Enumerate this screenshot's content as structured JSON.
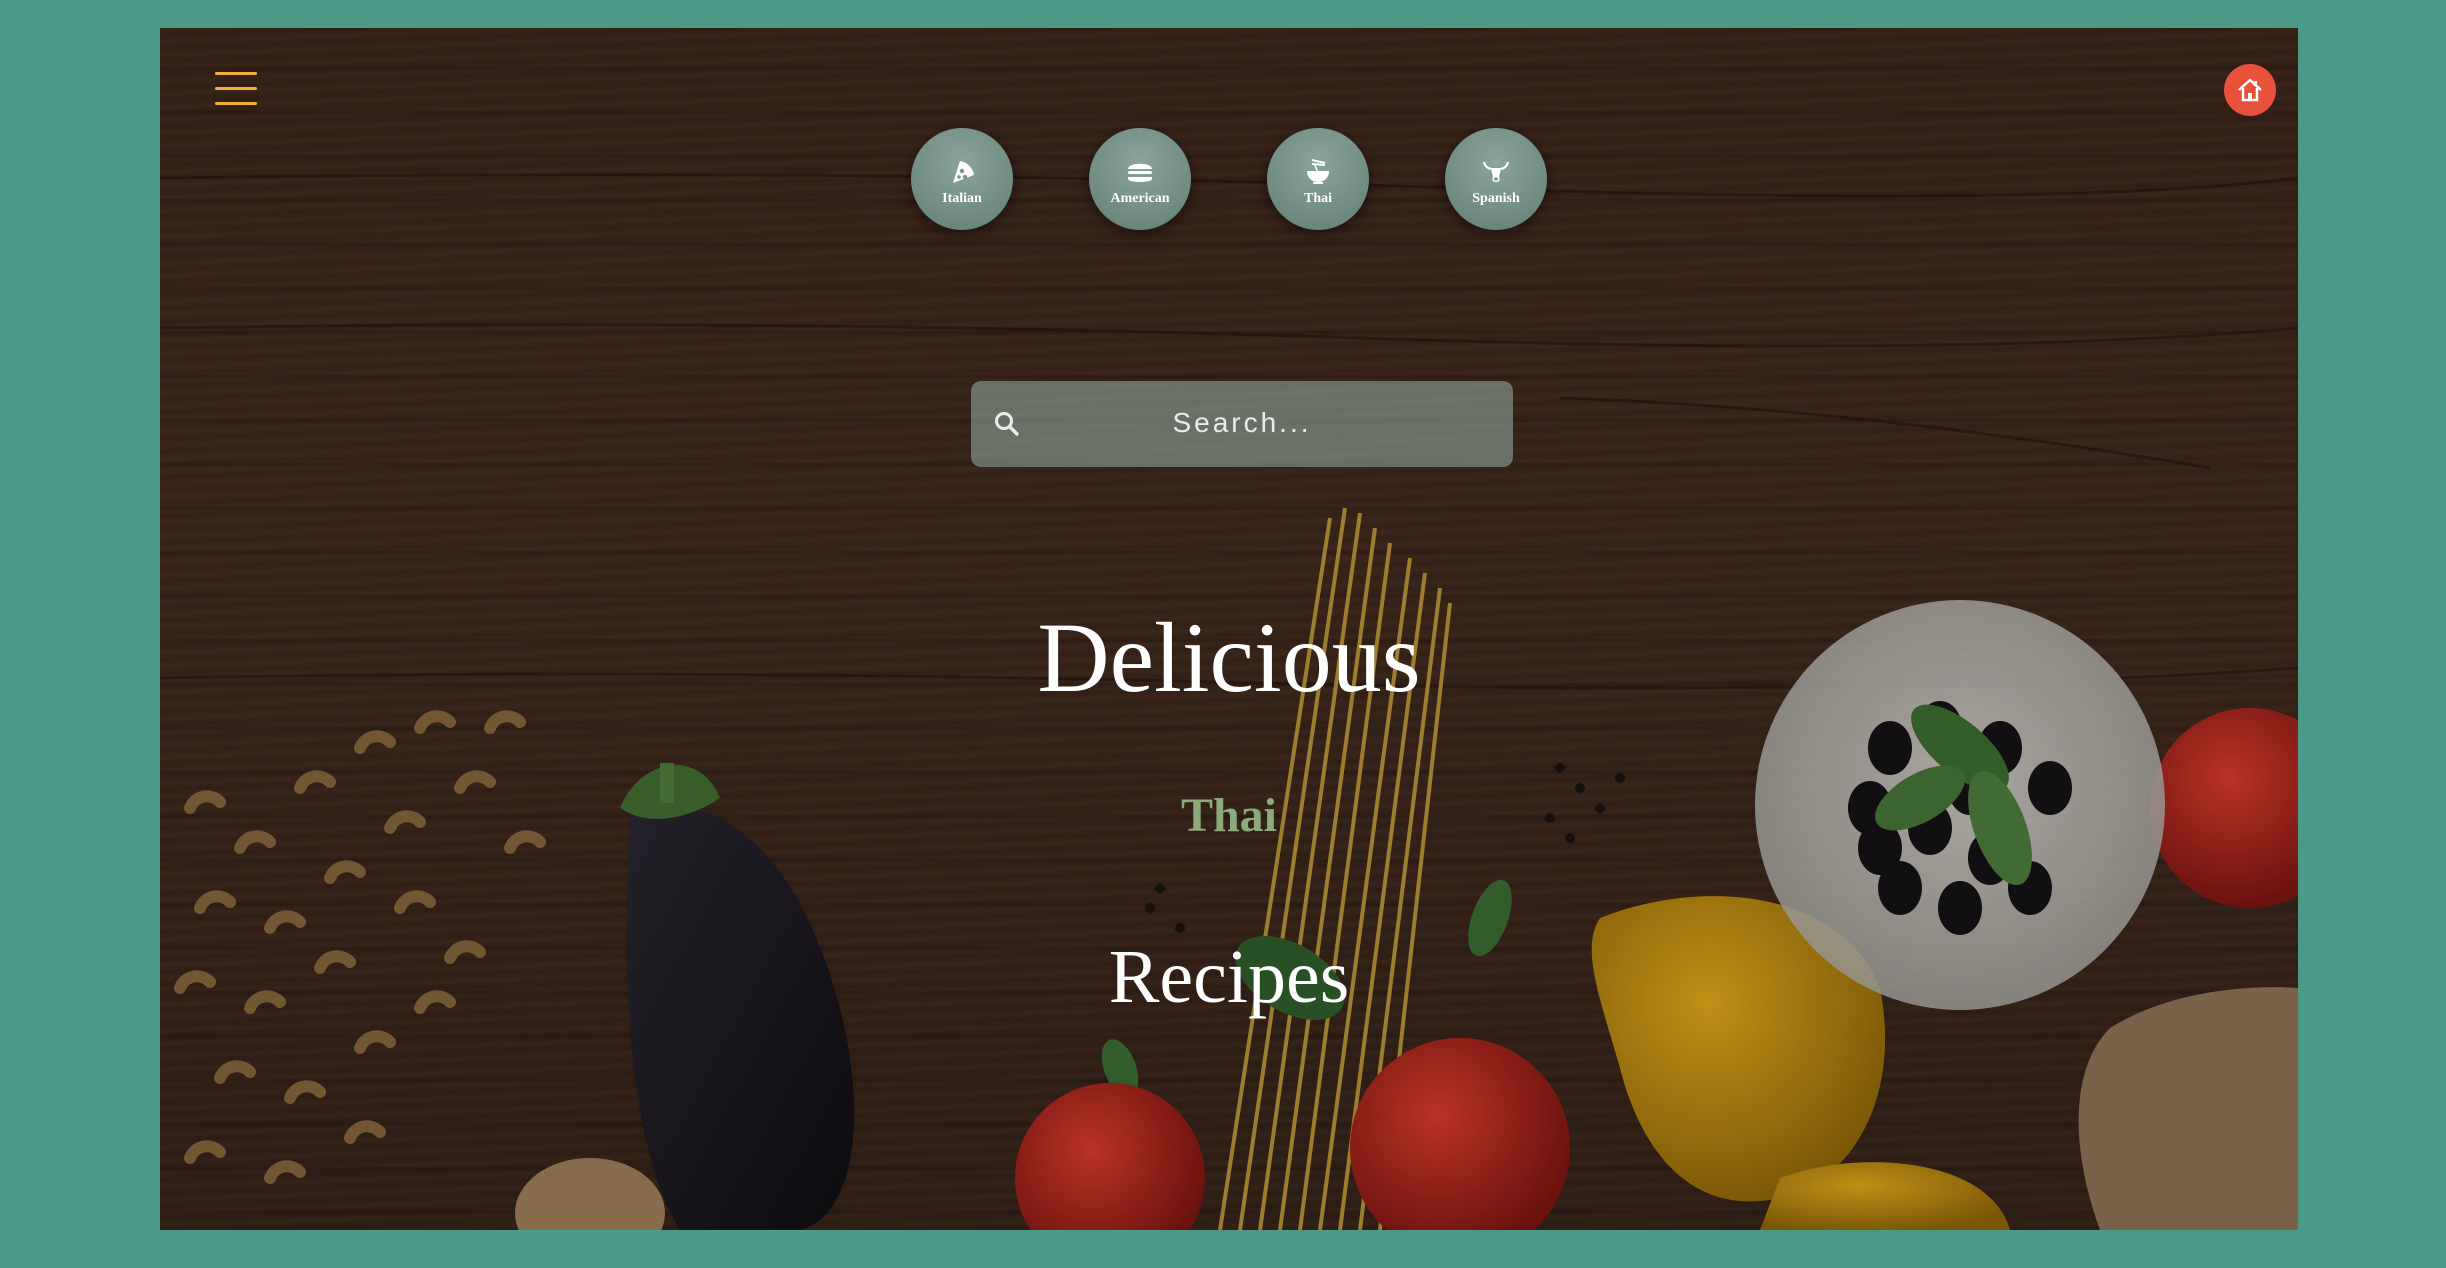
{
  "header": {
    "menu_icon": "hamburger-menu-icon",
    "home_icon": "home-icon"
  },
  "cuisines": [
    {
      "label": "Italian",
      "icon": "pizza-icon"
    },
    {
      "label": "American",
      "icon": "burger-icon"
    },
    {
      "label": "Thai",
      "icon": "noodle-bowl-icon"
    },
    {
      "label": "Spanish",
      "icon": "bull-icon"
    }
  ],
  "search": {
    "placeholder": "Search...",
    "icon": "search-icon"
  },
  "hero": {
    "title_top": "Delicious",
    "selected_cuisine": "Thai",
    "title_bottom": "Recipes"
  },
  "colors": {
    "page_background": "#4a9a87",
    "menu_accent": "#f2b23a",
    "home_button": "#e8513c",
    "cuisine_highlight": "#8dab7a"
  }
}
